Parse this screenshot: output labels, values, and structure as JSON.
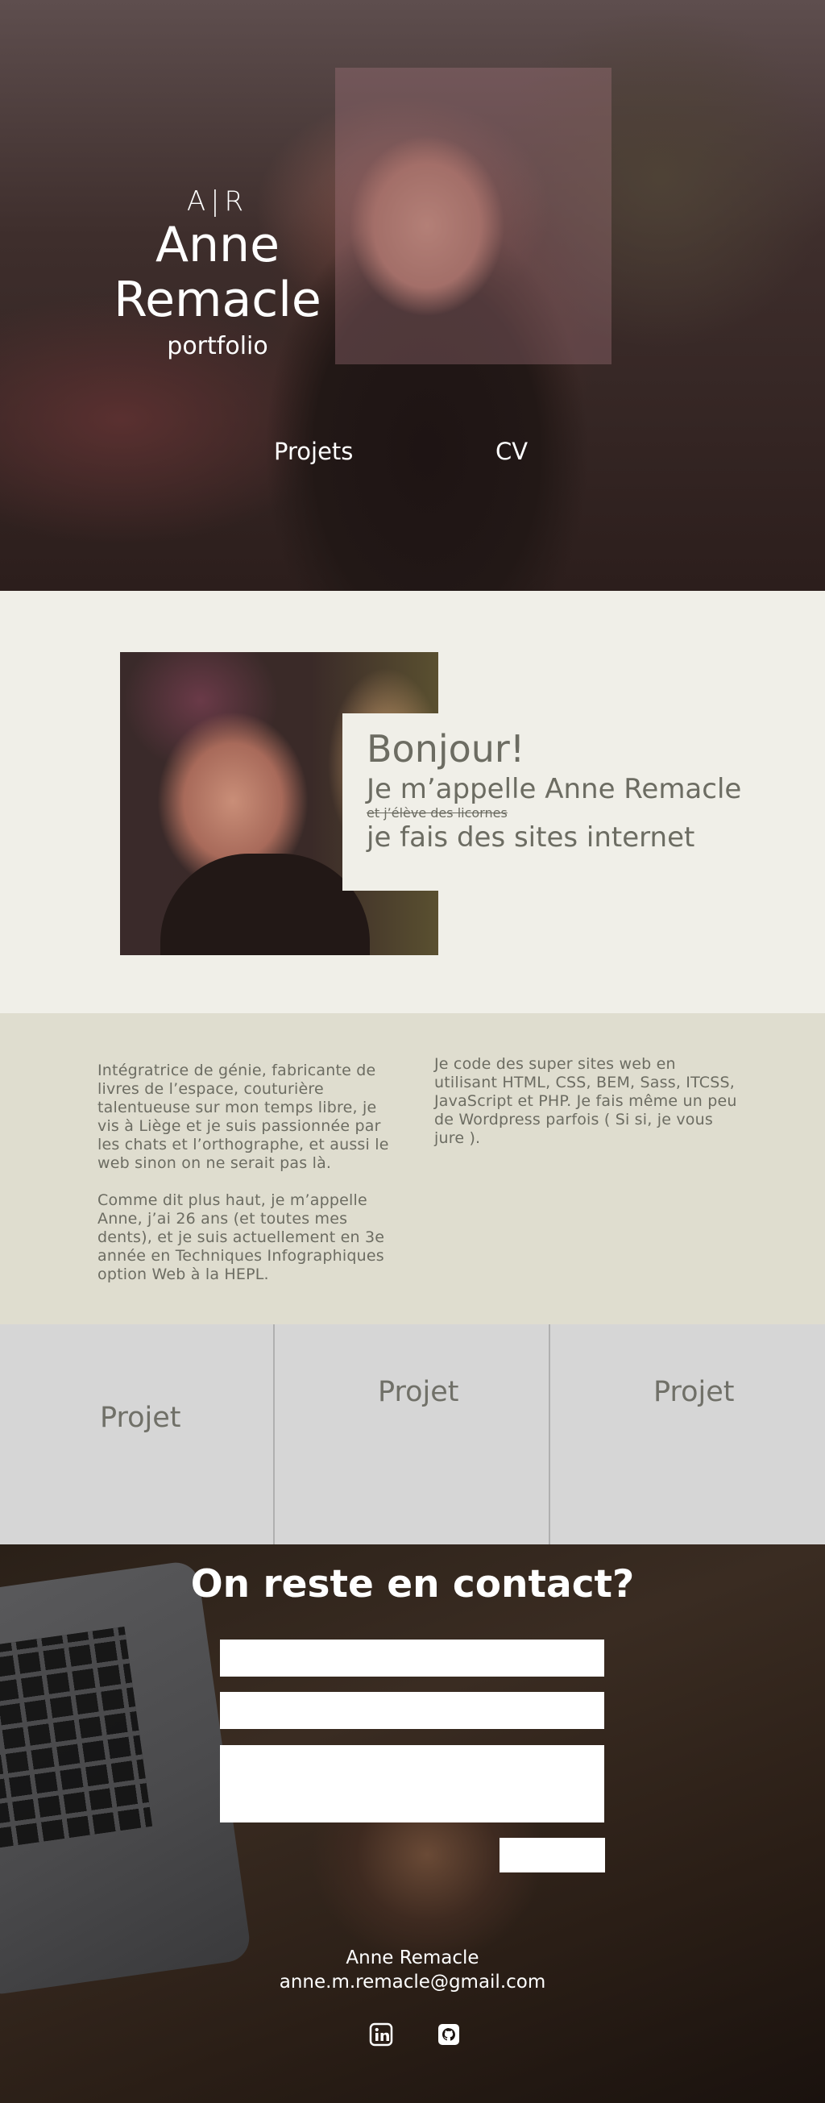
{
  "hero": {
    "monogram": "A|R",
    "name": "Anne Remacle",
    "subtitle": "portfolio",
    "nav": [
      {
        "label": "Projets"
      },
      {
        "label": "CV"
      }
    ]
  },
  "about": {
    "greeting": "Bonjour!",
    "intro": "Je m’appelle Anne Remacle",
    "strikethrough": "et j’élève des licornes",
    "job": "je fais des sites internet"
  },
  "description": {
    "left_p1": "Intégratrice de génie, fabricante de livres de l’espace, couturière talentueuse sur mon temps libre, je vis à Liège et je suis passionnée par les chats et l’orthographe, et aussi le web sinon on ne serait pas là.",
    "left_p2": "Comme dit plus haut, je m’appelle Anne, j’ai 26 ans (et toutes mes dents), et je suis actuellement en 3e année en Techniques Infographiques option Web à la HEPL.",
    "right_p1": "Je code des super sites web en utilisant HTML, CSS, BEM, Sass, ITCSS, JavaScript et PHP. Je fais même un peu de Wordpress parfois ( Si si, je vous jure )."
  },
  "projects": [
    {
      "label": "Projet"
    },
    {
      "label": "Projet"
    },
    {
      "label": "Projet"
    }
  ],
  "contact": {
    "title": "On reste en contact?",
    "footer_name": "Anne Remacle",
    "footer_email": "anne.m.remacle@gmail.com",
    "social_icons": [
      "linkedin-icon",
      "github-icon"
    ]
  }
}
